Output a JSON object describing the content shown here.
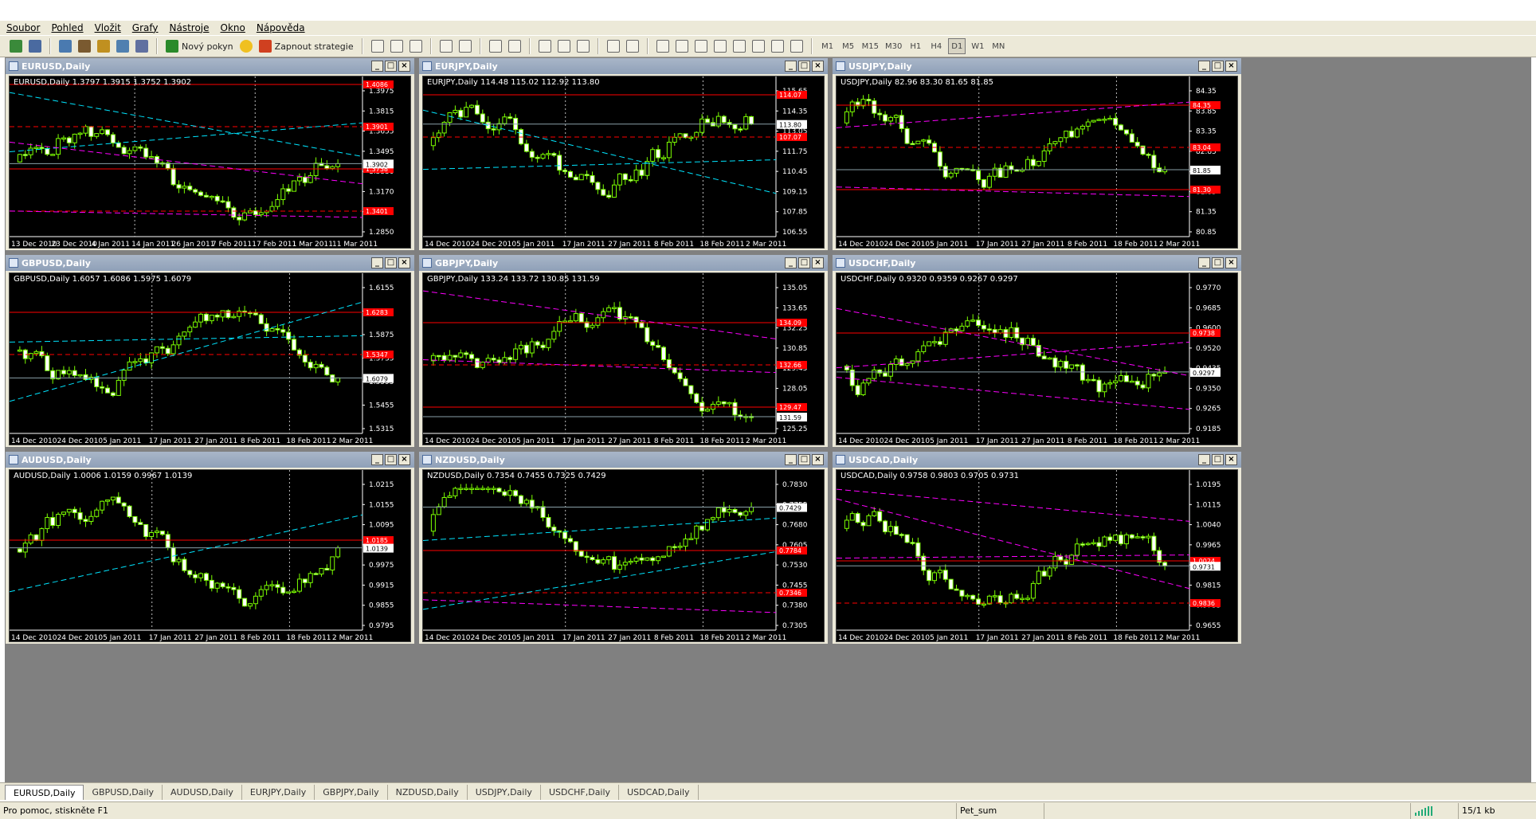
{
  "menu": [
    "Soubor",
    "Pohled",
    "Vložit",
    "Grafy",
    "Nástroje",
    "Okno",
    "Nápověda"
  ],
  "toolbar": {
    "new_order": "Nový pokyn",
    "strategies": "Zapnout strategie",
    "timeframes": [
      "M1",
      "M5",
      "M15",
      "M30",
      "H1",
      "H4",
      "D1",
      "W1",
      "MN"
    ],
    "active_timeframe": "D1"
  },
  "charts": [
    {
      "title": "EURUSD,Daily",
      "ohlc": "EURUSD,Daily  1.3797 1.3915 1.3752 1.3902",
      "price_labels": [
        "1.3975",
        "1.3815",
        "1.3655",
        "1.3495",
        "1.3330",
        "1.3170",
        "1.3010",
        "1.2850"
      ],
      "dates": [
        "13 Dec 2010",
        "23 Dec 2010",
        "4 Jan 2011",
        "14 Jan 2011",
        "26 Jan 2011",
        "7 Feb 2011",
        "17 Feb 2011",
        "1 Mar 2011",
        "11 Mar 2011"
      ],
      "marker_current": "1.3902",
      "markers": [
        "1.4086",
        "1.3901",
        "1.3738",
        "1.3401"
      ],
      "start": 1.318,
      "end": 1.3902,
      "lines": [
        "cyan",
        "cyan",
        "magenta",
        "magenta"
      ]
    },
    {
      "title": "EURJPY,Daily",
      "ohlc": "EURJPY,Daily  114.48 115.02 112.92 113.80",
      "price_labels": [
        "115.65",
        "114.35",
        "113.05",
        "111.75",
        "110.45",
        "109.15",
        "107.85",
        "106.55"
      ],
      "dates": [
        "14 Dec 2010",
        "24 Dec 2010",
        "5 Jan 2011",
        "17 Jan 2011",
        "27 Jan 2011",
        "8 Feb 2011",
        "18 Feb 2011",
        "2 Mar 2011"
      ],
      "marker_current": "113.80",
      "markers": [
        "114.07",
        "107.07"
      ],
      "start": 110.8,
      "end": 113.8,
      "lines": [
        "cyan",
        "cyan"
      ]
    },
    {
      "title": "USDJPY,Daily",
      "ohlc": "USDJPY,Daily  82.96 83.30 81.65 81.85",
      "price_labels": [
        "84.35",
        "83.85",
        "83.35",
        "82.85",
        "82.35",
        "81.85",
        "81.35",
        "80.85"
      ],
      "dates": [
        "14 Dec 2010",
        "24 Dec 2010",
        "5 Jan 2011",
        "17 Jan 2011",
        "27 Jan 2011",
        "8 Feb 2011",
        "18 Feb 2011",
        "2 Mar 2011"
      ],
      "marker_current": "81.85",
      "markers": [
        "84.35",
        "83.04",
        "81.30"
      ],
      "start": 84.0,
      "end": 81.85,
      "lines": [
        "magenta",
        "magenta"
      ]
    },
    {
      "title": "GBPUSD,Daily",
      "ohlc": "GBPUSD,Daily  1.6057 1.6086 1.5975 1.6079",
      "price_labels": [
        "1.6155",
        "1.6015",
        "1.5875",
        "1.5735",
        "1.5595",
        "1.5455",
        "1.5315"
      ],
      "dates": [
        "14 Dec 2010",
        "24 Dec 2010",
        "5 Jan 2011",
        "17 Jan 2011",
        "27 Jan 2011",
        "8 Feb 2011",
        "18 Feb 2011",
        "2 Mar 2011"
      ],
      "marker_current": "1.6079",
      "markers": [
        "1.6283",
        "1.5347"
      ],
      "start": 1.56,
      "end": 1.6079,
      "lines": [
        "cyan",
        "cyan"
      ]
    },
    {
      "title": "GBPJPY,Daily",
      "ohlc": "GBPJPY,Daily  133.24 133.72 130.85 131.59",
      "price_labels": [
        "135.05",
        "133.65",
        "132.25",
        "130.85",
        "129.45",
        "128.05",
        "126.65",
        "125.25"
      ],
      "dates": [
        "14 Dec 2010",
        "24 Dec 2010",
        "5 Jan 2011",
        "17 Jan 2011",
        "27 Jan 2011",
        "8 Feb 2011",
        "18 Feb 2011",
        "2 Mar 2011"
      ],
      "marker_current": "131.59",
      "markers": [
        "134.09",
        "132.66",
        "129.47"
      ],
      "start": 130.5,
      "end": 131.59,
      "lines": [
        "magenta",
        "magenta"
      ]
    },
    {
      "title": "USDCHF,Daily",
      "ohlc": "USDCHF,Daily  0.9320 0.9359 0.9267 0.9297",
      "price_labels": [
        "0.9770",
        "0.9685",
        "0.9600",
        "0.9520",
        "0.9435",
        "0.9350",
        "0.9265",
        "0.9185"
      ],
      "dates": [
        "14 Dec 2010",
        "24 Dec 2010",
        "5 Jan 2011",
        "17 Jan 2011",
        "27 Jan 2011",
        "8 Feb 2011",
        "18 Feb 2011",
        "2 Mar 2011"
      ],
      "marker_current": "0.9297",
      "markers": [
        "0.9738"
      ],
      "start": 0.968,
      "end": 0.9297,
      "lines": [
        "magenta",
        "magenta",
        "magenta"
      ]
    },
    {
      "title": "AUDUSD,Daily",
      "ohlc": "AUDUSD,Daily  1.0006 1.0159 0.9967 1.0139",
      "price_labels": [
        "1.0215",
        "1.0155",
        "1.0095",
        "1.0035",
        "0.9975",
        "0.9915",
        "0.9855",
        "0.9795"
      ],
      "dates": [
        "14 Dec 2010",
        "24 Dec 2010",
        "5 Jan 2011",
        "17 Jan 2011",
        "27 Jan 2011",
        "8 Feb 2011",
        "18 Feb 2011",
        "2 Mar 2011"
      ],
      "marker_current": "1.0139",
      "markers": [
        "1.0185"
      ],
      "start": 0.99,
      "end": 1.0139,
      "lines": [
        "cyan"
      ]
    },
    {
      "title": "NZDUSD,Daily",
      "ohlc": "NZDUSD,Daily  0.7354 0.7455 0.7325 0.7429",
      "price_labels": [
        "0.7830",
        "0.7755",
        "0.7680",
        "0.7605",
        "0.7530",
        "0.7455",
        "0.7380",
        "0.7305"
      ],
      "dates": [
        "14 Dec 2010",
        "24 Dec 2010",
        "5 Jan 2011",
        "17 Jan 2011",
        "27 Jan 2011",
        "8 Feb 2011",
        "18 Feb 2011",
        "2 Mar 2011"
      ],
      "marker_current": "0.7429",
      "markers": [
        "0.7784",
        "0.7346"
      ],
      "start": 0.74,
      "end": 0.7429,
      "lines": [
        "cyan",
        "cyan",
        "magenta"
      ]
    },
    {
      "title": "USDCAD,Daily",
      "ohlc": "USDCAD,Daily  0.9758 0.9803 0.9705 0.9731",
      "price_labels": [
        "1.0195",
        "1.0115",
        "1.0040",
        "0.9965",
        "0.9890",
        "0.9815",
        "0.9735",
        "0.9655"
      ],
      "dates": [
        "14 Dec 2010",
        "24 Dec 2010",
        "5 Jan 2011",
        "17 Jan 2011",
        "27 Jan 2011",
        "8 Feb 2011",
        "18 Feb 2011",
        "2 Mar 2011"
      ],
      "marker_current": "0.9731",
      "markers": [
        "1.0024",
        "0.9836"
      ],
      "start": 1.0,
      "end": 0.9731,
      "lines": [
        "magenta",
        "magenta",
        "magenta"
      ]
    }
  ],
  "tabs": [
    "EURUSD,Daily",
    "GBPUSD,Daily",
    "AUDUSD,Daily",
    "EURJPY,Daily",
    "GBPJPY,Daily",
    "NZDUSD,Daily",
    "USDJPY,Daily",
    "USDCHF,Daily",
    "USDCAD,Daily"
  ],
  "active_tab": "EURUSD,Daily",
  "status": {
    "help": "Pro pomoc, stiskněte F1",
    "profile": "Pet_sum",
    "traffic": "15/1 kb"
  },
  "colors": {
    "bull": "#000000",
    "bear": "#ffffff",
    "candle_up_outline": "#7cff00",
    "support": "#ff0000",
    "cyan": "#00e5ff",
    "magenta": "#ff00ff"
  }
}
